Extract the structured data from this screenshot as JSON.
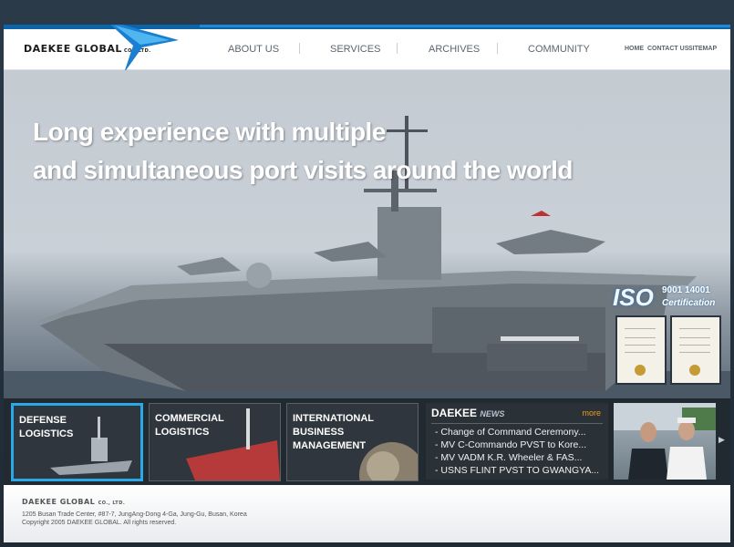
{
  "header": {
    "logo_text": "DAEKEE GLOBAL",
    "logo_suffix": "CO., LTD.",
    "nav": [
      "ABOUT US",
      "SERVICES",
      "ARCHIVES",
      "COMMUNITY"
    ],
    "util": [
      "HOME",
      "CONTACT US",
      "SITEMAP"
    ]
  },
  "hero": {
    "line1": "Long experience with multiple",
    "line2": "and simultaneous port visits around the world",
    "iso_label": "ISO",
    "iso_number": "9001 14001",
    "iso_caption": "Certification"
  },
  "tiles": [
    {
      "line1": "DEFENSE",
      "line2": "LOGISTICS"
    },
    {
      "line1": "COMMERCIAL",
      "line2": "LOGISTICS"
    },
    {
      "line1": "INTERNATIONAL",
      "line2": "BUSINESS MANAGEMENT"
    }
  ],
  "news": {
    "title": "DAEKEE",
    "title_suffix": "NEWS",
    "more": "more",
    "items": [
      "- Change of Command Ceremony...",
      "- MV C-Commando PVST to Kore...",
      "- MV VADM K.R. Wheeler & FAS...",
      "- USNS FLINT PVST TO GWANGYA..."
    ]
  },
  "footer": {
    "logo": "DAEKEE GLOBAL",
    "logo_suffix": "CO., LTD.",
    "address": "1205 Busan Trade Center, #87-7, JungAng-Dong 4-Ga, Jung-Gu, Busan, Korea",
    "copyright": "Copyright 2005 DAEKEE GLOBAL. All rights reserved."
  },
  "colors": {
    "accent": "#2aa9e6",
    "brand_blue": "#0b63a8",
    "news_more": "#f29a1e"
  }
}
